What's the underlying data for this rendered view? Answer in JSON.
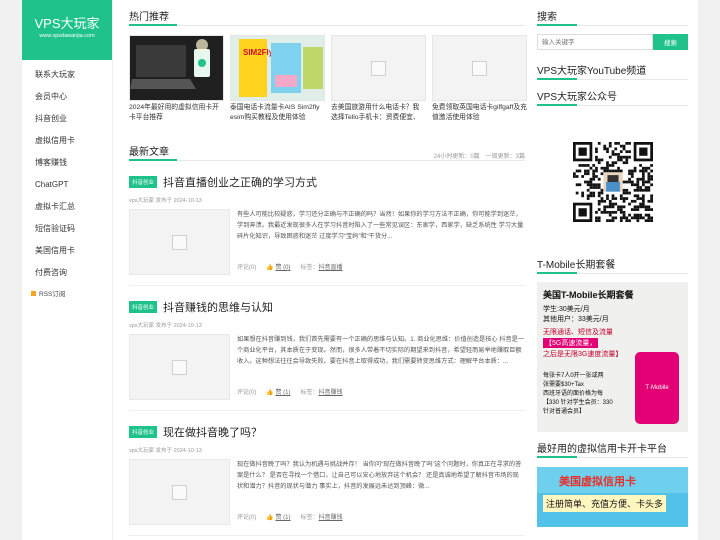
{
  "site": {
    "title": "VPS大玩家",
    "url": "www.vpsdawanjia.com"
  },
  "nav": [
    {
      "label": "联系大玩家"
    },
    {
      "label": "会员中心"
    },
    {
      "label": "抖音创业"
    },
    {
      "label": "虚拟信用卡"
    },
    {
      "label": "博客赚钱"
    },
    {
      "label": "ChatGPT"
    },
    {
      "label": "虚拟卡汇总"
    },
    {
      "label": "短信验证码"
    },
    {
      "label": "美国信用卡"
    },
    {
      "label": "付费咨询"
    }
  ],
  "rss": "RSS订阅",
  "hot": {
    "heading": "热门推荐",
    "items": [
      {
        "caption": "2024年最好用的虚拟信用卡开卡平台推荐"
      },
      {
        "caption": "泰国电话卡流量卡AIS Sim2fly esim购买教程及使用体验"
      },
      {
        "caption": "去美国旅游用什么电话卡？我选择Tello手机卡：资费便宜、"
      },
      {
        "caption": "免费领取英国电话卡giffgaff及充值激活使用体验"
      }
    ],
    "sim_label": "SIM2Fly"
  },
  "latest": {
    "heading": "最新文章",
    "stats": "24小时更新：0篇　一周更新：3篇",
    "posts": [
      {
        "tag": "抖音创业",
        "title": "抖音直播创业之正确的学习方式",
        "meta": "vps大玩家 发布于 2024-10-13",
        "excerpt": "有些人可能比较疑惑，学习还分正确与不正确的吗？当然！如果你的学习方法不正确，你可能学到迷茫，学到奔溃。我最近发现很多人在学习抖音时陷入了一些常见误区：东家学，西家学，缺乏系统性 学习大量碎片化知识，导致困惑和迷茫 过度学习“宝妈”和“干货分...",
        "comments": "评论(0)",
        "likes": "赞 (0)",
        "tags_label": "标签：",
        "tags": "抖音直播"
      },
      {
        "tag": "抖音创业",
        "title": "抖音赚钱的思维与认知",
        "meta": "vps大玩家 发布于 2024-10-13",
        "excerpt": "如果想在抖音赚到钱，我们首先需要有一个正确的思维与认知。1. 商业化思维：价值创造是核心 抖音是一个商业化平台，其本质在于变现。然而，很多人带着不切实际的期望来到抖音，希望轻而易举地赚取巨额收入。这种想法往往会导致失败。要在抖音上取得成功，我们需要转变思维方式：理解平台本质：...",
        "comments": "评论(0)",
        "likes": "赞 (1)",
        "tags_label": "标签：",
        "tags": "抖音赚钱"
      },
      {
        "tag": "抖音创业",
        "title": "现在做抖音晚了吗？",
        "meta": "vps大玩家 发布于 2024-10-13",
        "excerpt": "现在做抖音晚了吗？我认为机遇与挑战并存！ 当你问“现在做抖音晚了吗”这个问题时，你真正在寻求的答案是什么？ 是否在寻找一个借口，让自己可以安心地放弃这个机会？ 还是真诚地希望了解抖音市场的现状和潜力？抖音的现状与潜力 事实上，抖音的发展远未达到顶峰：微...",
        "comments": "评论(0)",
        "likes": "赞 (1)",
        "tags_label": "标签：",
        "tags": "抖音赚钱"
      }
    ]
  },
  "right": {
    "search_heading": "搜索",
    "search_placeholder": "输入关键字",
    "search_button": "搜索",
    "youtube_heading": "VPS大玩家YouTube频道",
    "wechat_heading": "VPS大玩家公众号",
    "tmobile_heading": "T-Mobile长期套餐",
    "tmobile_ad": {
      "title": "美国T-Mobile长期套餐",
      "l1": "学生:30美元/月",
      "l2": "其他用户：33美元/月",
      "l3": "无限通话、短信及流量",
      "l4": "【5G高速流量，",
      "l5": "之后是无限3G速度流量】",
      "l6": "每张卡7人0开一张或两",
      "l7": "张需要$30+Tax",
      "l8": "西班牙语的面价格为每",
      "l9": "【330 针对学生会员：330",
      "l10": "针对普通会员】",
      "brand": "T·Mobile"
    },
    "vcc_heading": "最好用的虚拟信用卡开卡平台",
    "vcc_ad": {
      "title": "美国虚拟信用卡",
      "sub": "注册简单、充值方便、卡头多"
    }
  }
}
